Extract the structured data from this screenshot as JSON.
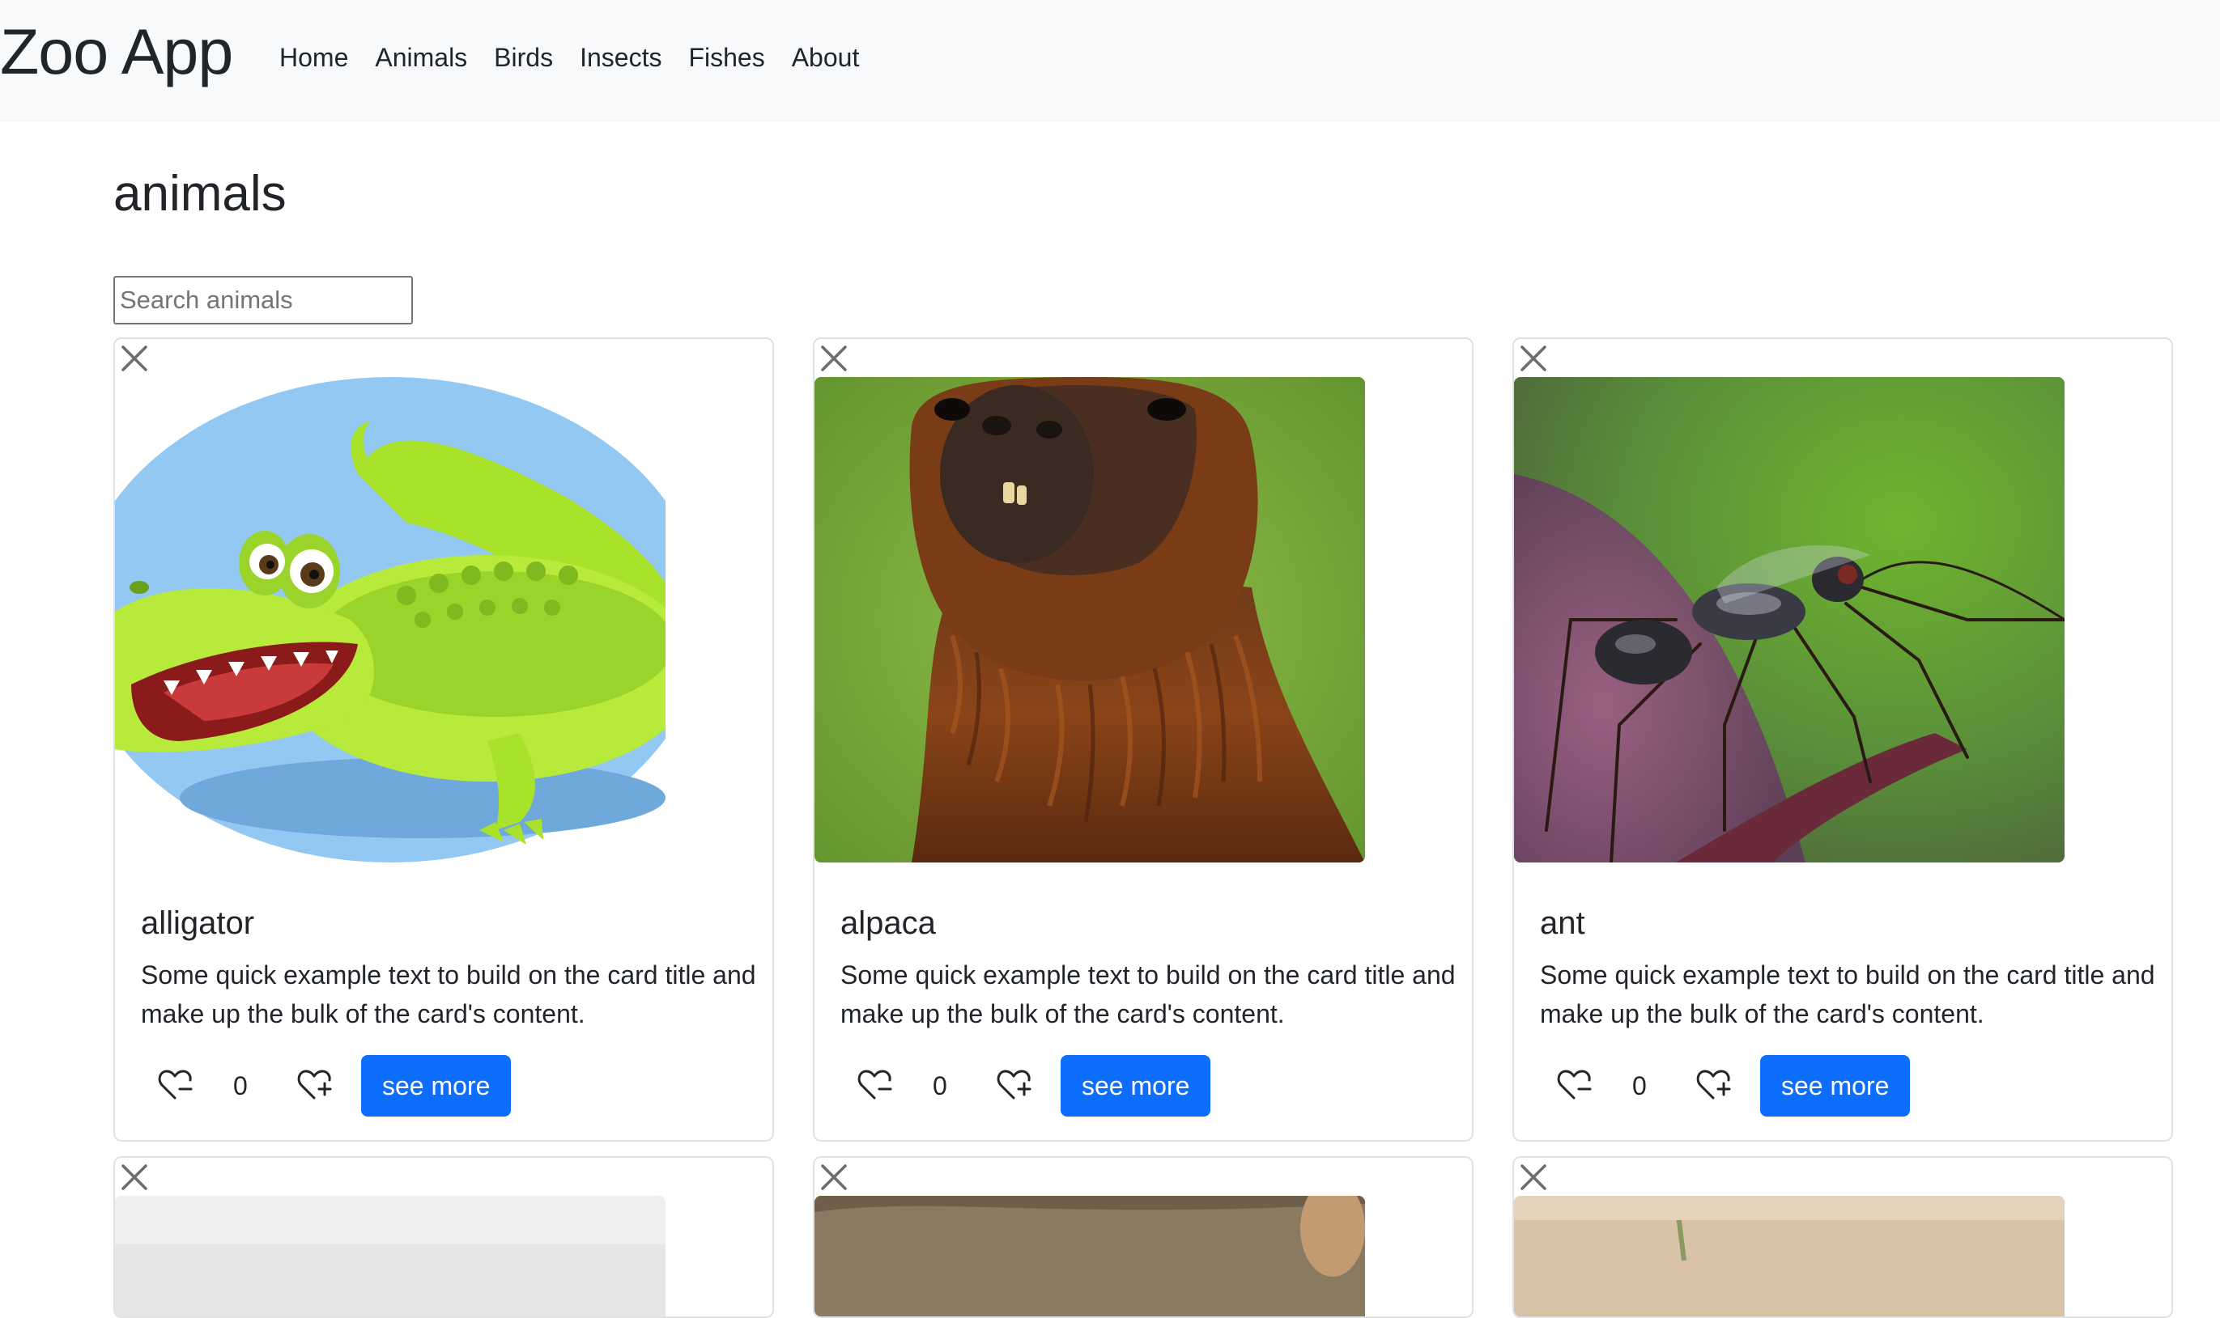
{
  "navbar": {
    "brand": "Zoo App",
    "links": [
      {
        "label": "Home"
      },
      {
        "label": "Animals"
      },
      {
        "label": "Birds"
      },
      {
        "label": "Insects"
      },
      {
        "label": "Fishes"
      },
      {
        "label": "About"
      }
    ]
  },
  "page": {
    "title": "animals",
    "search_placeholder": "Search animals",
    "search_value": ""
  },
  "cards": [
    {
      "title": "alligator",
      "text": "Some quick example text to build on the card title and make up the bulk of the card's content.",
      "likes": "0",
      "button_label": "see more",
      "image": "alligator-cartoon"
    },
    {
      "title": "alpaca",
      "text": "Some quick example text to build on the card title and make up the bulk of the card's content.",
      "likes": "0",
      "button_label": "see more",
      "image": "alpaca-photo"
    },
    {
      "title": "ant",
      "text": "Some quick example text to build on the card title and make up the bulk of the card's content.",
      "likes": "0",
      "button_label": "see more",
      "image": "ant-photo"
    }
  ],
  "icons": {
    "close": "close-icon",
    "heart_minus": "heart-minus-icon",
    "heart_plus": "heart-plus-icon"
  },
  "colors": {
    "navbar_bg": "#f8f9fa",
    "primary": "#0d6efd",
    "text": "#212529",
    "border": "#dee2e6"
  }
}
